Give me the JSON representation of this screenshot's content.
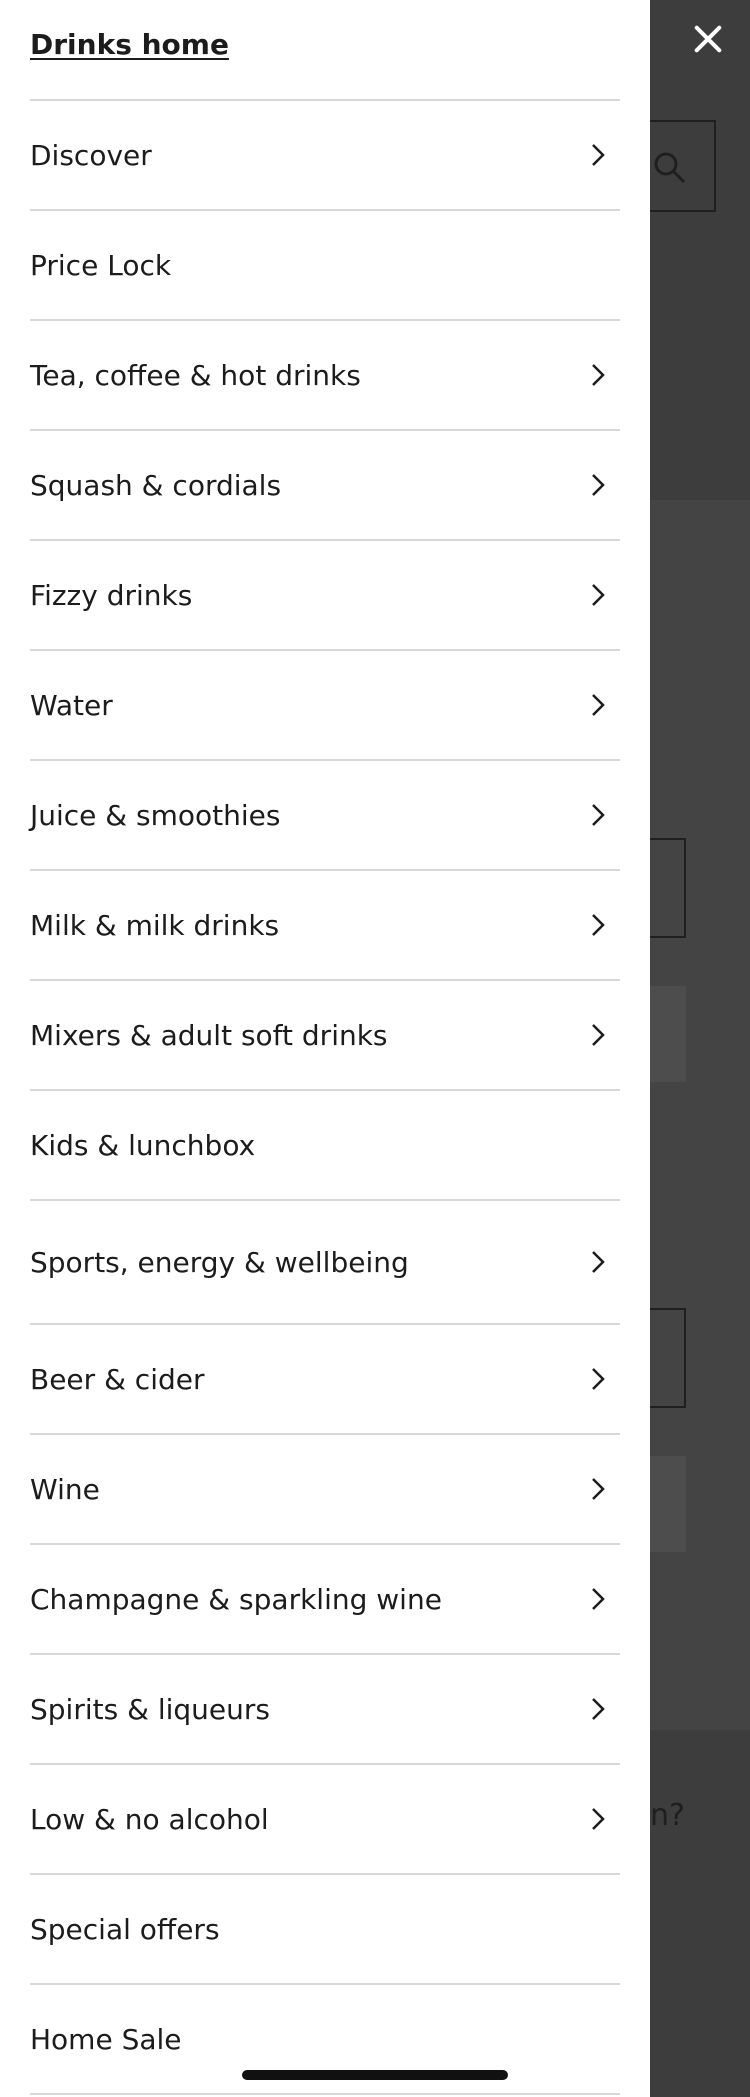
{
  "drawer": {
    "home_link": "Drinks home",
    "items": [
      {
        "label": "Discover",
        "has_chevron": true
      },
      {
        "label": "Price Lock",
        "has_chevron": false
      },
      {
        "label": "Tea, coffee & hot drinks",
        "has_chevron": true
      },
      {
        "label": "Squash & cordials",
        "has_chevron": true
      },
      {
        "label": "Fizzy drinks",
        "has_chevron": true
      },
      {
        "label": "Water",
        "has_chevron": true
      },
      {
        "label": "Juice & smoothies",
        "has_chevron": true
      },
      {
        "label": "Milk & milk drinks",
        "has_chevron": true
      },
      {
        "label": "Mixers & adult soft drinks",
        "has_chevron": true
      },
      {
        "label": "Kids & lunchbox",
        "has_chevron": false
      },
      {
        "label": "Sports, energy & wellbeing",
        "has_chevron": true
      },
      {
        "label": "Beer & cider",
        "has_chevron": true
      },
      {
        "label": "Wine",
        "has_chevron": true
      },
      {
        "label": "Champagne & sparkling wine",
        "has_chevron": true
      },
      {
        "label": "Spirits & liqueurs",
        "has_chevron": true
      },
      {
        "label": "Low & no alcohol",
        "has_chevron": true
      },
      {
        "label": "Special offers",
        "has_chevron": false
      },
      {
        "label": "Home Sale",
        "has_chevron": false
      }
    ]
  },
  "background": {
    "partial_text": "n?"
  },
  "icons": {
    "close": "close-icon",
    "search": "search-icon",
    "chevron": "chevron-right-icon"
  },
  "colors": {
    "overlay": "#3d3d3d",
    "drawer_bg": "#ffffff",
    "divider": "#d8d8d8",
    "text": "#1c1c1c"
  }
}
